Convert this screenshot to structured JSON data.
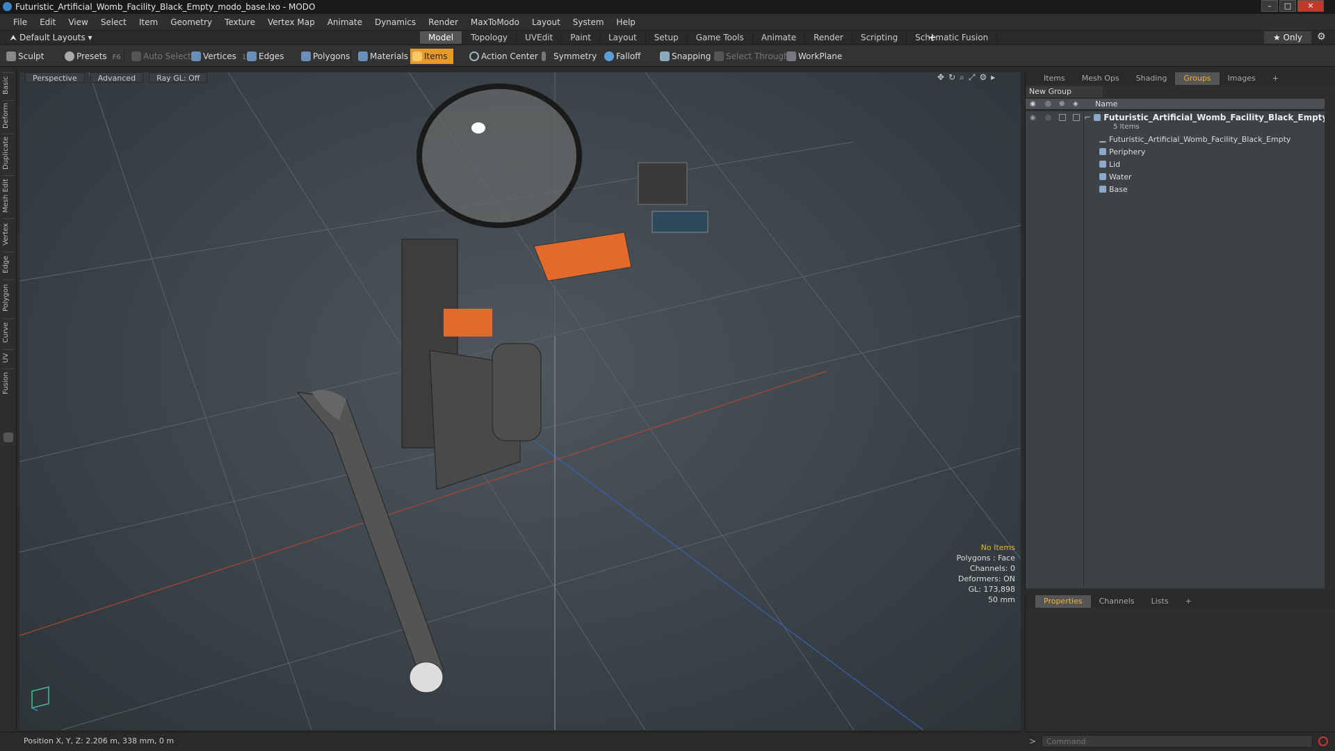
{
  "window": {
    "title": "Futuristic_Artificial_Womb_Facility_Black_Empty_modo_base.lxo - MODO"
  },
  "menu": [
    "File",
    "Edit",
    "View",
    "Select",
    "Item",
    "Geometry",
    "Texture",
    "Vertex Map",
    "Animate",
    "Dynamics",
    "Render",
    "MaxToModo",
    "Layout",
    "System",
    "Help"
  ],
  "layout_selector": "Default Layouts ▾",
  "mode_tabs": [
    "Model",
    "Topology",
    "UVEdit",
    "Paint",
    "Layout",
    "Setup",
    "Game Tools",
    "Animate",
    "Render",
    "Scripting",
    "Schematic Fusion"
  ],
  "active_mode_tab": "Model",
  "only_label": "★  Only",
  "toolbar": {
    "sculpt": "Sculpt",
    "presets": "Presets",
    "presets_key": "F6",
    "auto_select": "Auto Select",
    "vertices": "Vertices",
    "vertices_count": "1",
    "edges": "Edges",
    "edges_count": "2",
    "polygons": "Polygons",
    "materials": "Materials",
    "items": "Items",
    "action_center": "Action Center",
    "symmetry": "Symmetry",
    "falloff": "Falloff",
    "snapping": "Snapping",
    "select_through": "Select Through",
    "workplane": "WorkPlane"
  },
  "left_tabs": [
    "Basic",
    "Deform",
    "Duplicate",
    "Mesh Edit",
    "Vertex",
    "Edge",
    "Polygon",
    "Curve",
    "UV",
    "Fusion"
  ],
  "viewport": {
    "view": "Perspective",
    "style": "Advanced",
    "raygl": "Ray GL: Off",
    "hud": {
      "selection": "No Items",
      "polygons": "Polygons : Face",
      "channels": "Channels: 0",
      "deformers": "Deformers: ON",
      "gl": "GL: 173,898",
      "scale": "50 mm"
    }
  },
  "right_panel": {
    "tabs": [
      "Items",
      "Mesh Ops",
      "Shading",
      "Groups",
      "Images"
    ],
    "active_tab": "Groups",
    "new_group": "New Group",
    "column_name": "Name",
    "tree": {
      "root": "Futuristic_Artificial_Womb_Facility_Black_Empty (...",
      "root_sub": "5 Items",
      "children": [
        "Futuristic_Artificial_Womb_Facility_Black_Empty",
        "Periphery",
        "Lid",
        "Water",
        "Base"
      ]
    }
  },
  "bottom_panel": {
    "tabs": [
      "Properties",
      "Channels",
      "Lists"
    ],
    "active_tab": "Properties"
  },
  "status": {
    "position": "Position X, Y, Z:  2.206 m, 338 mm, 0 m"
  },
  "command": {
    "placeholder": "Command"
  }
}
